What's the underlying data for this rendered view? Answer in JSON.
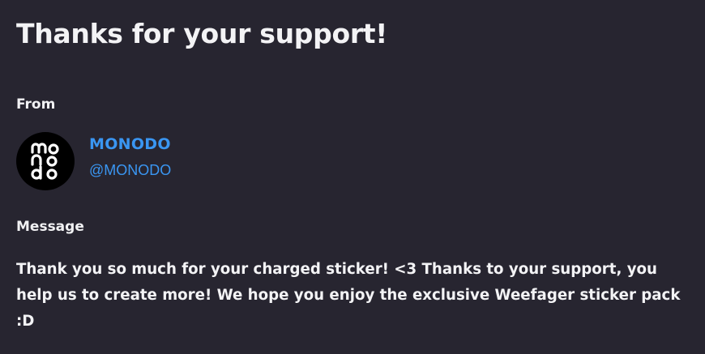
{
  "title": "Thanks for your support!",
  "from": {
    "label": "From",
    "sender_name": "MONODO",
    "sender_handle": "@MONODO",
    "avatar_icon": "monodo-logo-icon"
  },
  "message": {
    "label": "Message",
    "text": "Thank you so much for your charged sticker! <3 Thanks to your support, you help us to create more! We hope you enjoy the exclusive Weefager sticker pack :D"
  },
  "colors": {
    "background": "#272530",
    "accent": "#3a96f2",
    "text": "#f3f3f5"
  }
}
